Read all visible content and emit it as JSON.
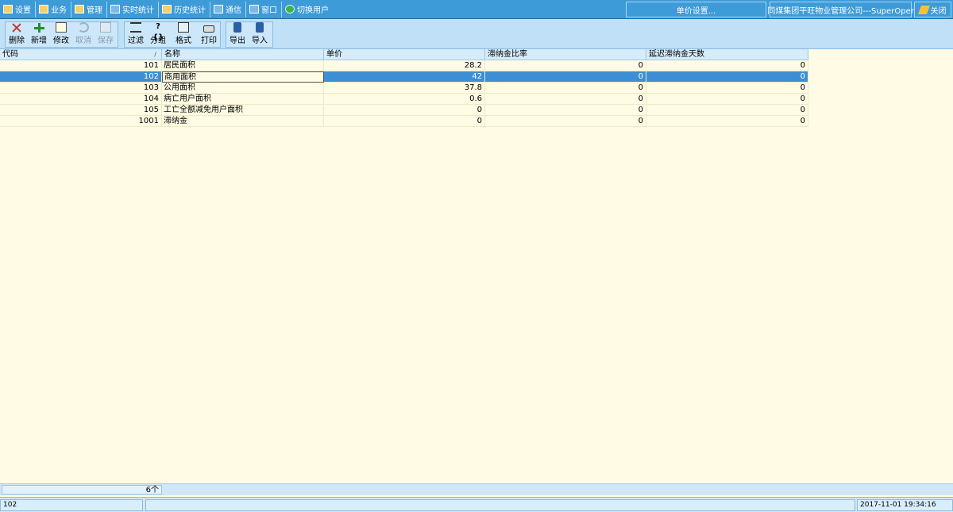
{
  "menubar": {
    "items": [
      {
        "label": "设置",
        "icon": "settings-icon"
      },
      {
        "label": "业务",
        "icon": "business-icon"
      },
      {
        "label": "管理",
        "icon": "manage-icon"
      },
      {
        "label": "实时统计",
        "icon": "realtime-stats-icon"
      },
      {
        "label": "历史统计",
        "icon": "history-stats-icon"
      },
      {
        "label": "通信",
        "icon": "communication-icon"
      },
      {
        "label": "窗口",
        "icon": "window-icon"
      },
      {
        "label": "切换用户",
        "icon": "switch-user-icon"
      }
    ],
    "current_form": "单价设置...",
    "company_user": "同煤集团平旺物业管理公司---SuperOper",
    "close_label": "关闭"
  },
  "toolbar": {
    "delete": "删除",
    "add": "新增",
    "edit": "修改",
    "cancel": "取消",
    "save": "保存",
    "filter": "过滤",
    "group": "分组",
    "format": "格式",
    "print": "打印",
    "export": "导出",
    "import": "导入"
  },
  "table": {
    "columns": [
      "代码",
      "名称",
      "单价",
      "滞纳金比率",
      "延迟滞纳金天数"
    ],
    "sort_indicator": "/",
    "rows": [
      {
        "code": "101",
        "name": "居民面积",
        "price": "28.2",
        "rate": "0",
        "days": "0"
      },
      {
        "code": "102",
        "name": "商用面积",
        "price": "42",
        "rate": "0",
        "days": "0"
      },
      {
        "code": "103",
        "name": "公用面积",
        "price": "37.8",
        "rate": "0",
        "days": "0"
      },
      {
        "code": "104",
        "name": "病亡用户面积",
        "price": "0.6",
        "rate": "0",
        "days": "0"
      },
      {
        "code": "105",
        "name": "工亡全额减免用户面积",
        "price": "0",
        "rate": "0",
        "days": "0"
      },
      {
        "code": "1001",
        "name": "滞纳金",
        "price": "0",
        "rate": "0",
        "days": "0"
      }
    ],
    "selected_row": 1,
    "record_count": "6个"
  },
  "statusbar": {
    "current_code": "102",
    "middle": "",
    "datetime": "2017-11-01 19:34:16"
  },
  "colors": {
    "menubar": "#3d9bd8",
    "toolbar": "#bfe0f7",
    "grid_bg": "#fffbe4",
    "selection": "#3c8fd6"
  }
}
